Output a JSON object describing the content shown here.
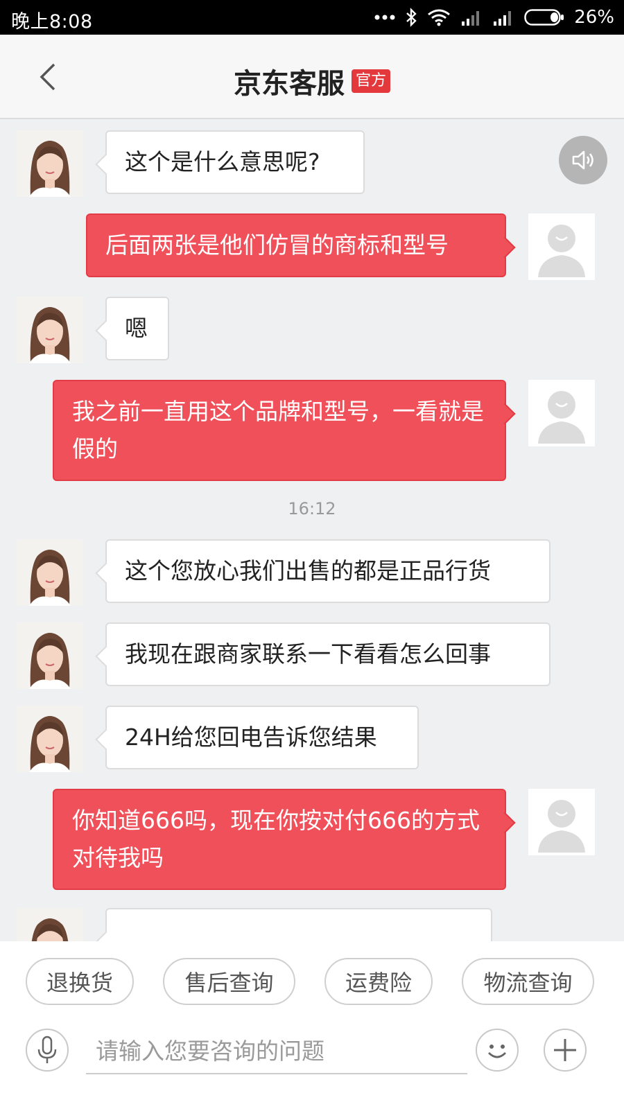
{
  "status_bar": {
    "time": "晚上8:08",
    "battery": "26%"
  },
  "header": {
    "title": "京东客服",
    "badge": "官方"
  },
  "messages": [
    {
      "from": "agent",
      "text": "这个是什么意思呢?"
    },
    {
      "from": "user",
      "text": "后面两张是他们仿冒的商标和型号"
    },
    {
      "from": "agent",
      "text": "嗯"
    },
    {
      "from": "user",
      "text": "我之前一直用这个品牌和型号，一看就是假的"
    },
    {
      "from": "agent",
      "text": "这个您放心我们出售的都是正品行货"
    },
    {
      "from": "agent",
      "text": "我现在跟商家联系一下看看怎么回事"
    },
    {
      "from": "agent",
      "text": "24H给您回电告诉您结果"
    },
    {
      "from": "user",
      "text": "你知道666吗，现在你按对付666的方式对待我吗"
    }
  ],
  "timestamp": "16:12",
  "quick_replies": [
    "退换货",
    "售后查询",
    "运费险",
    "物流查询"
  ],
  "input": {
    "placeholder": "请输入您要咨询的问题"
  },
  "colors": {
    "accent": "#e4393c",
    "user_bubble": "#f0505a",
    "background": "#eff0f2"
  }
}
